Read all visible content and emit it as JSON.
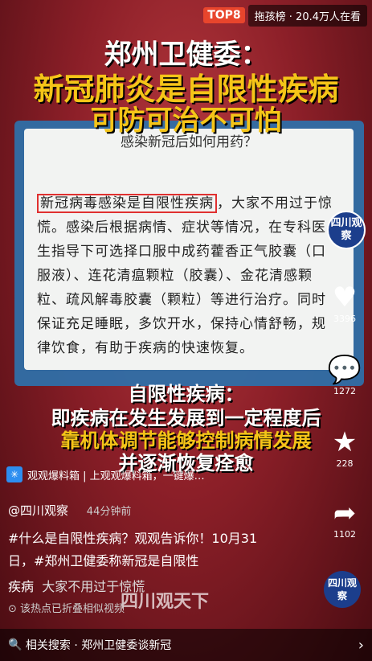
{
  "top_badge": "TOP8",
  "top_rank_text": "拖孩榜 · 20.4万人在看",
  "title_line1": "郑州卫健委：",
  "title_line2": "新冠肺炎是自限性疾病",
  "title_line3": "可防可治不可怕",
  "card": {
    "subtitle": "感染新冠后如何用药？",
    "highlight": "新冠病毒感染是自限性疾病",
    "body": "，大家不用过于惊慌。感染后根据病情、症状等情况，在专科医生指导下可选择口服中成药藿香正气胶囊（口服液）、连花清瘟颗粒（胶囊）、金花清感颗粒、疏风解毒胶囊（颗粒）等进行治疗。同时保证充足睡眠，多饮开水，保持心情舒畅，规律饮食，有助于疾病的快速恢复。"
  },
  "subtitle_lines": [
    "自限性疾病：",
    "即疾病在发生发展到一定程度后",
    "靠机体调节能够控制病情发展",
    "并逐渐恢复痊愈"
  ],
  "side": {
    "avatar_text": "四川观察",
    "likes": "3396",
    "comments": "1272",
    "favorites": "228",
    "shares": "1102"
  },
  "mini_app": "观观爆料箱 | 上观观爆料箱，一键爆…",
  "author": "@四川观察",
  "post_time": "44分钟前",
  "description": "#什么是自限性疾病？观观告诉你！10月31日，#郑州卫健委称新冠是自限性",
  "description_line2": "疾病",
  "description_tail": "大家不用过于惊慌",
  "hint": "该热点已折叠相似视频",
  "watermark": "四川观天下",
  "related_search": "相关搜索 · 郑州卫健委谈新冠",
  "corner_logo": "四川观察",
  "colors": {
    "accent_yellow": "#f5c518",
    "badge_red": "#e8452c",
    "highlight_border": "#e03030"
  }
}
